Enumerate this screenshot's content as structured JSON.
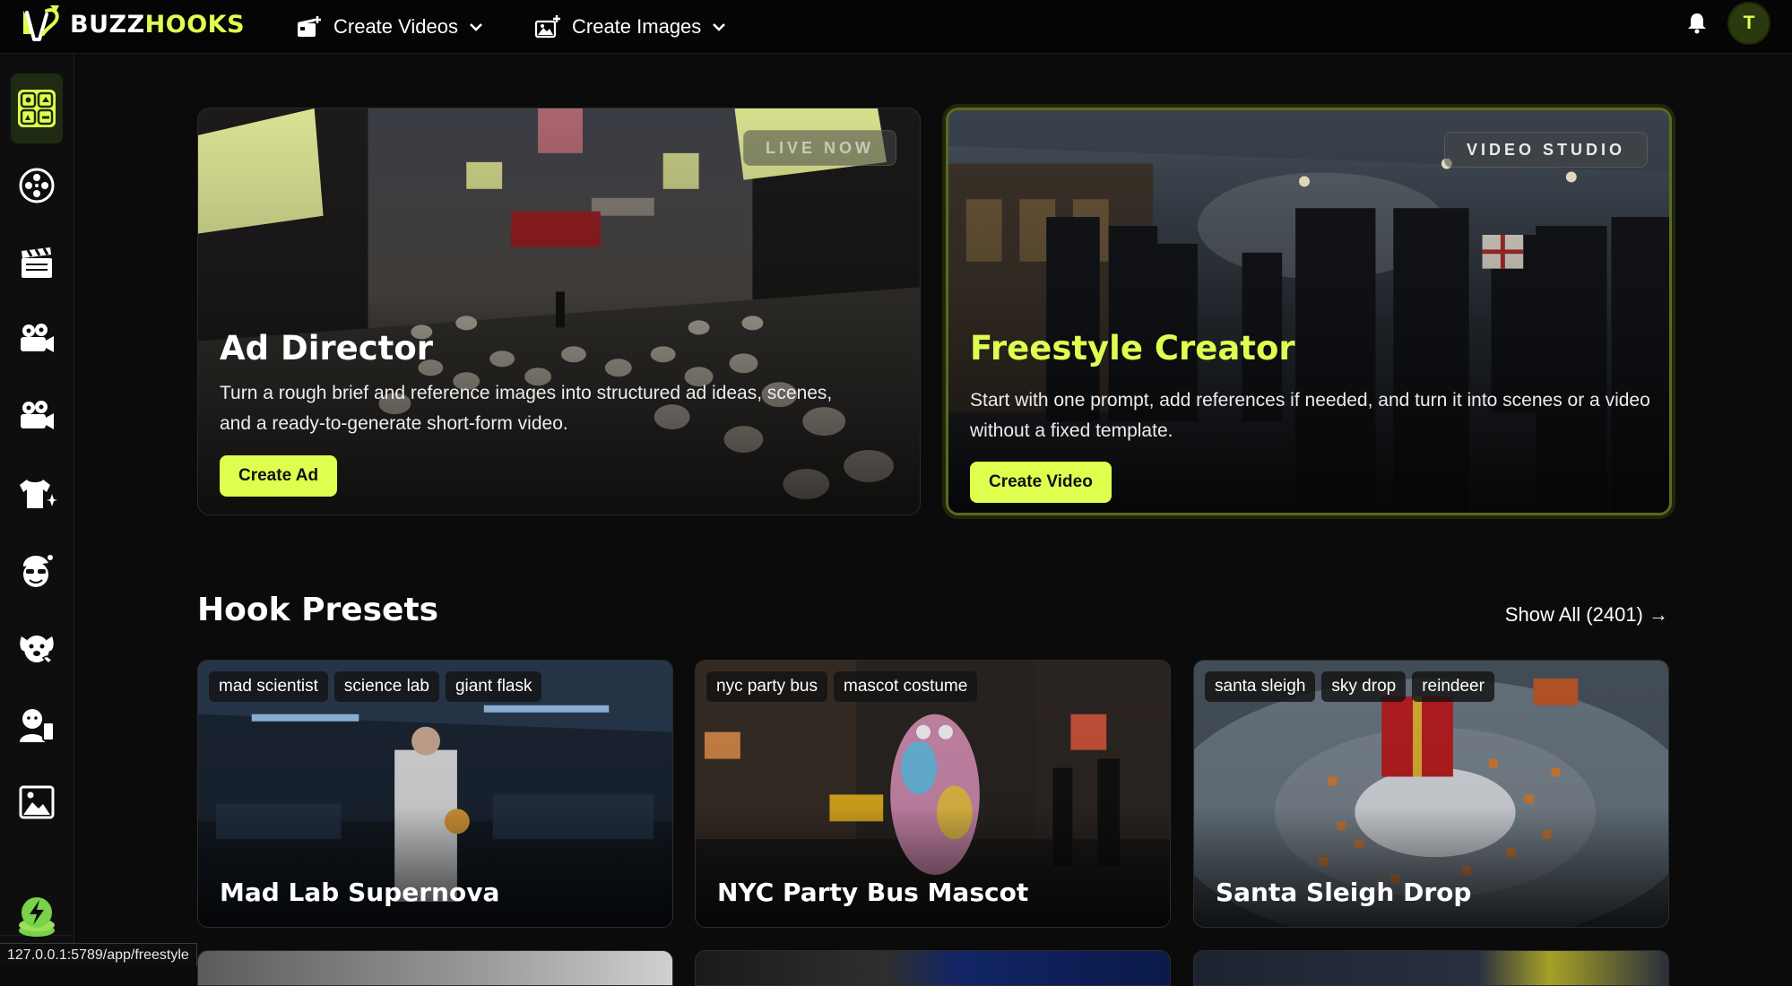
{
  "header": {
    "brand_prefix": "BUZZ",
    "brand_suffix": "HOOKS",
    "nav": [
      {
        "label": "Create Videos",
        "icon": "video-plus-icon"
      },
      {
        "label": "Create Images",
        "icon": "image-plus-icon"
      }
    ],
    "avatar_initial": "T"
  },
  "sidebar": {
    "items": [
      {
        "name": "dashboard",
        "icon": "grid-apps-icon",
        "active": true
      },
      {
        "name": "reels",
        "icon": "film-reel-icon"
      },
      {
        "name": "clapperboard",
        "icon": "clapperboard-icon"
      },
      {
        "name": "camera-1",
        "icon": "movie-camera-icon"
      },
      {
        "name": "camera-2",
        "icon": "movie-camera-icon"
      },
      {
        "name": "apparel",
        "icon": "tshirt-sparkle-icon"
      },
      {
        "name": "character",
        "icon": "santa-face-icon"
      },
      {
        "name": "pets",
        "icon": "dog-face-icon"
      },
      {
        "name": "avatar",
        "icon": "person-phone-icon"
      },
      {
        "name": "images",
        "icon": "image-icon"
      }
    ],
    "credits_icon": "coins-bolt-icon",
    "status_url": "127.0.0.1:5789/app/freestyle"
  },
  "hero": {
    "ad_director": {
      "badge": "LIVE NOW",
      "title": "Ad Director",
      "description": "Turn a rough brief and reference images into structured ad ideas, scenes, and a ready-to-generate short-form video.",
      "cta": "Create Ad"
    },
    "freestyle": {
      "badge": "VIDEO STUDIO",
      "title": "Freestyle Creator",
      "description": "Start with one prompt, add references if needed, and turn it into scenes or a video without a fixed template.",
      "cta": "Create Video"
    }
  },
  "presets": {
    "title": "Hook Presets",
    "show_all": "Show All (2401) →",
    "cards": [
      {
        "title": "Mad Lab Supernova",
        "tags": [
          "mad scientist",
          "science lab",
          "giant flask"
        ]
      },
      {
        "title": "NYC Party Bus Mascot",
        "tags": [
          "nyc party bus",
          "mascot costume"
        ]
      },
      {
        "title": "Santa Sleigh Drop",
        "tags": [
          "santa sleigh",
          "sky drop",
          "reindeer"
        ]
      }
    ]
  },
  "colors": {
    "accent": "#dfff4f",
    "background": "#0b0b0b"
  }
}
